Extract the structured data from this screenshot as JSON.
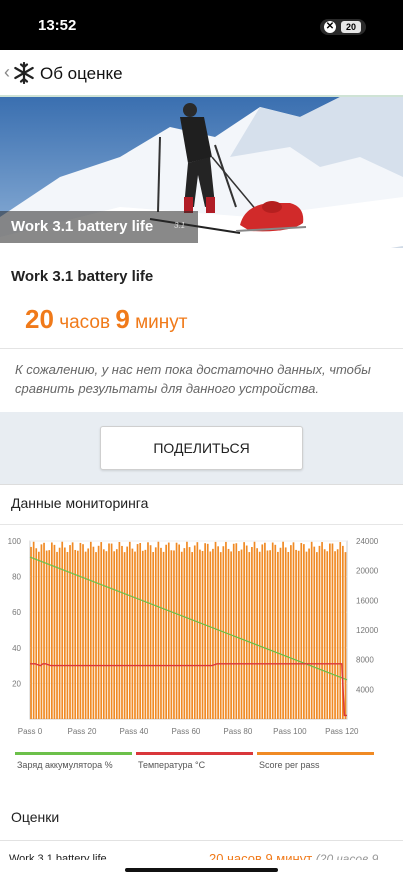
{
  "status_bar": {
    "time": "13:52",
    "battery": "20"
  },
  "header": {
    "title": "Об оценке"
  },
  "hero": {
    "caption": "Work 3.1 battery life",
    "badge": "3.1"
  },
  "result": {
    "test_name": "Work 3.1 battery life",
    "hours": "20",
    "hours_unit": "часов",
    "minutes": "9",
    "minutes_unit": "минут"
  },
  "note": "К сожалению, у нас нет пока достаточно данных, чтобы сравнить результаты для данного устройства.",
  "share_button": "ПОДЕЛИТЬСЯ",
  "monitor": {
    "title": "Данные мониторинга"
  },
  "chart_data": {
    "type": "bar",
    "x_ticks": [
      "Pass 0",
      "Pass 20",
      "Pass 40",
      "Pass 60",
      "Pass 80",
      "Pass 100",
      "Pass 120"
    ],
    "x_range": [
      0,
      122
    ],
    "left_ticks": [
      "100",
      "80",
      "60",
      "40",
      "20"
    ],
    "left_range": [
      0,
      100
    ],
    "right_ticks": [
      "24000",
      "20000",
      "16000",
      "12000",
      "8000",
      "4000"
    ],
    "right_range": [
      0,
      24000
    ],
    "legend": [
      {
        "label": "Заряд аккумулятора %",
        "color": "#6cc04a"
      },
      {
        "label": "Температура °C",
        "color": "#d9373b"
      },
      {
        "label": "Score per pass",
        "color": "#f08a24"
      }
    ],
    "series": [
      {
        "name": "Score per pass",
        "axis": "right",
        "start": 0,
        "end": 122,
        "typical": 23500,
        "range": [
          22500,
          23900
        ]
      },
      {
        "name": "Заряд аккумулятора %",
        "axis": "left",
        "x": [
          0,
          122
        ],
        "values": [
          91,
          22
        ]
      },
      {
        "name": "Температура °C",
        "axis": "left",
        "x": [
          0,
          2,
          4,
          5,
          6,
          8,
          70,
          72,
          120,
          121,
          122
        ],
        "values": [
          31,
          31,
          30,
          31,
          31,
          30,
          30,
          31,
          31,
          2,
          2
        ]
      }
    ]
  },
  "ratings": {
    "title": "Оценки",
    "row_name": "Work 3.1 battery life",
    "row_value": "20 часов 9 минут",
    "row_extra": "(20 часов 9"
  }
}
